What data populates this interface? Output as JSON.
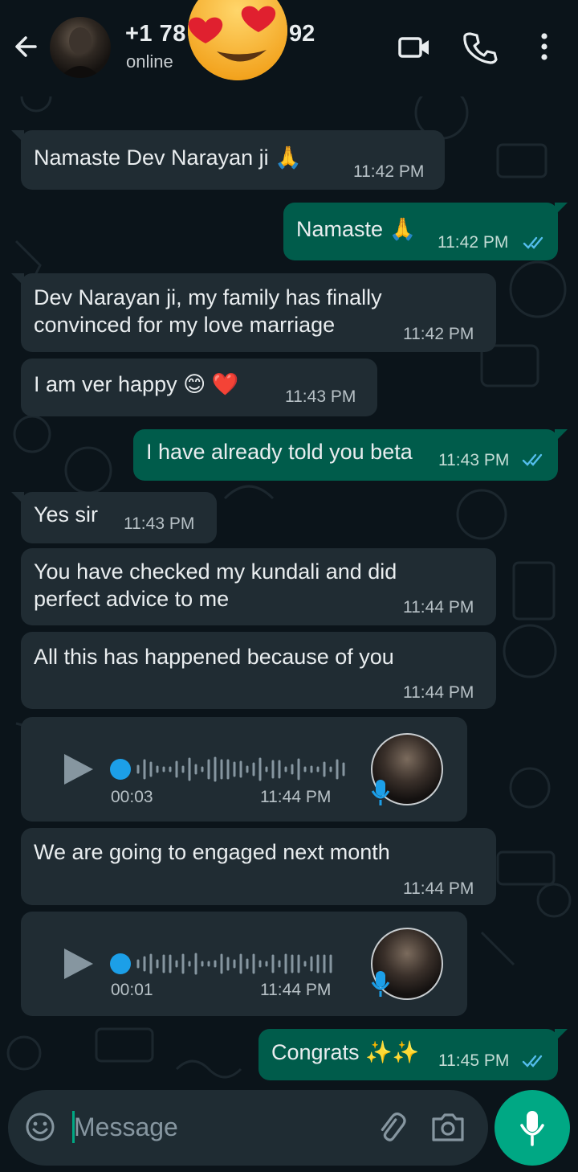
{
  "header": {
    "name_prefix": "+1 78",
    "name_suffix": "92",
    "status": "online"
  },
  "messages": [
    {
      "dir": "in",
      "text": "Namaste Dev Narayan ji 🙏",
      "time": "11:42 PM"
    },
    {
      "dir": "out",
      "text": "Namaste 🙏",
      "time": "11:42 PM"
    },
    {
      "dir": "in",
      "line1": "Dev Narayan ji, my family has finally",
      "line2": "convinced for my love marriage",
      "time": "11:42 PM"
    },
    {
      "dir": "in",
      "text": "I am ver happy 😊 ❤️",
      "time": "11:43 PM"
    },
    {
      "dir": "out",
      "text": "I have already told you beta",
      "time": "11:43 PM"
    },
    {
      "dir": "in",
      "text": "Yes sir",
      "time": "11:43 PM"
    },
    {
      "dir": "in",
      "line1": "You have checked my kundali and did",
      "line2": "perfect advice to me",
      "time": "11:44 PM"
    },
    {
      "dir": "in",
      "text": "All this has happened because of you",
      "time": "11:44 PM"
    },
    {
      "dir": "in",
      "type": "voice",
      "duration": "00:03",
      "time": "11:44 PM"
    },
    {
      "dir": "in",
      "text": "We are going to engaged next month",
      "time": "11:44 PM"
    },
    {
      "dir": "in",
      "type": "voice",
      "duration": "00:01",
      "time": "11:44 PM"
    },
    {
      "dir": "out",
      "text": "Congrats ✨✨",
      "time": "11:45 PM"
    }
  ],
  "input": {
    "placeholder": "Message"
  },
  "colors": {
    "background": "#0b141a",
    "incoming_bubble": "#202c33",
    "outgoing_bubble": "#005c4b",
    "accent": "#00a884",
    "read_ticks": "#53bdeb"
  },
  "icons": [
    "back-arrow-icon",
    "video-call-icon",
    "phone-icon",
    "more-options-icon",
    "play-icon",
    "microphone-icon",
    "emoji-icon",
    "attach-icon",
    "camera-icon"
  ]
}
